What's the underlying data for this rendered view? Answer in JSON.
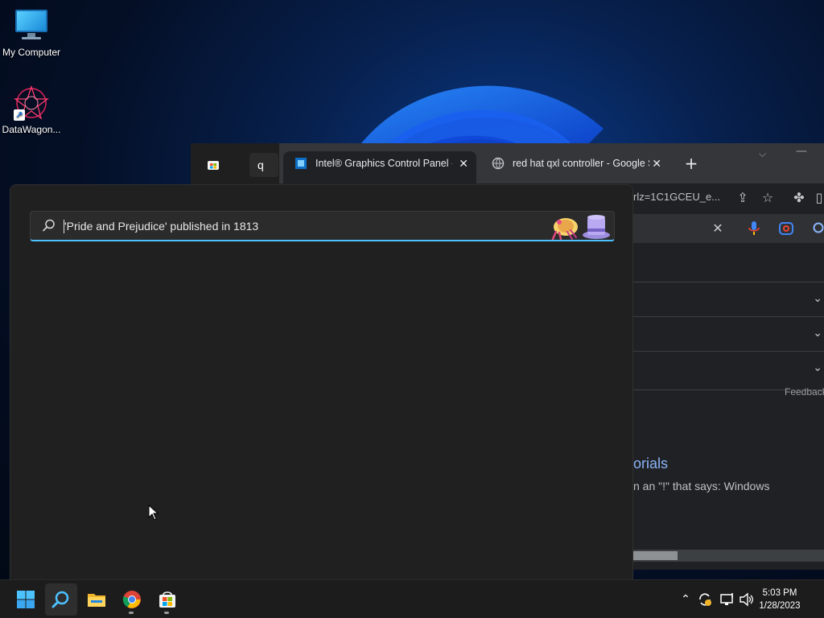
{
  "desktop": {
    "icons": [
      {
        "label": "My Computer"
      },
      {
        "label": "DataWagon..."
      }
    ]
  },
  "browser": {
    "store_tab_label": "q",
    "tabs": [
      {
        "label": "Intel® Graphics Control Panel - M"
      },
      {
        "label": "red hat qxl controller - Google Se"
      }
    ],
    "url_tail": "rlz=1C1GCEU_e...",
    "feedback": "Feedback",
    "result_title": "orials",
    "result_snippet": "n an \"!\" that says: Windows"
  },
  "search": {
    "value": "'Pride and Prejudice' published in 1813",
    "accent": "#4cc2ff"
  },
  "taskbar": {
    "apps": [
      "start-icon",
      "search-icon",
      "file-explorer-icon",
      "chrome-icon",
      "store-icon"
    ],
    "time": "5:03 PM",
    "date": "1/28/2023"
  }
}
